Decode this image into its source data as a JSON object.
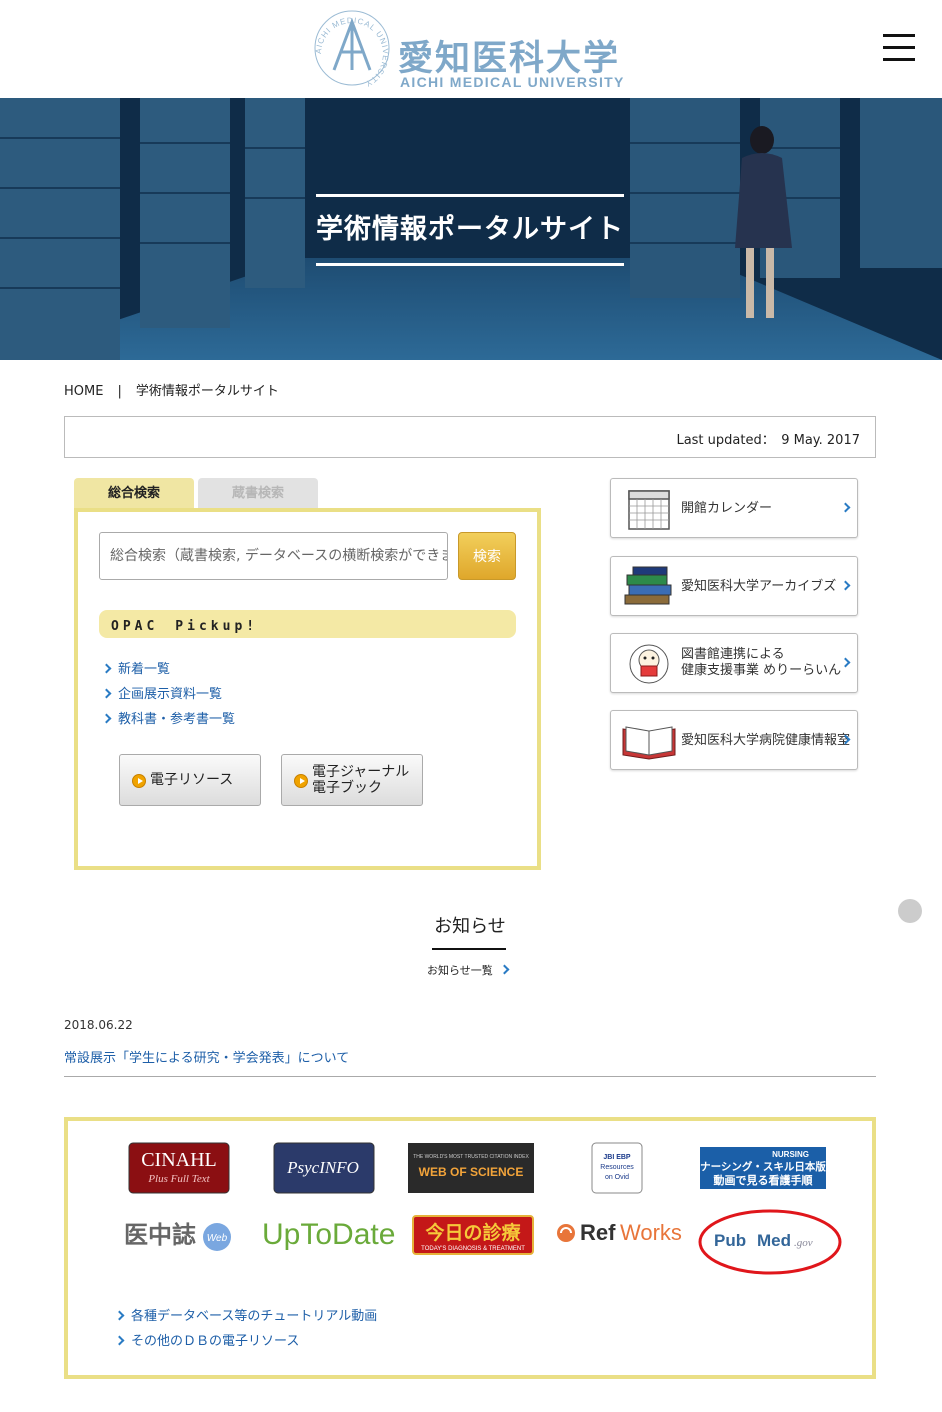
{
  "header": {
    "logo_ja": "愛知医科大学",
    "logo_en": "AICHI MEDICAL UNIVERSITY",
    "emblem_text": "AICHI MEDICAL UNIVERSITY"
  },
  "hero": {
    "title": "学術情報ポータルサイト"
  },
  "breadcrumb": {
    "home": "HOME",
    "separator": "|",
    "current": "学術情報ポータルサイト"
  },
  "updated": {
    "text": "Last updated：　9 May. 2017"
  },
  "search": {
    "tab_active": "総合検索",
    "tab_inactive": "蔵書検索",
    "placeholder": "総合検索（蔵書検索, データベースの横断検索ができます）",
    "button": "検索",
    "opac_title": "OPAC　Pickup!",
    "opac_links": [
      "新着一覧",
      "企画展示資料一覧",
      "教科書・参考書一覧"
    ],
    "resource_button": "電子リソース",
    "journal_button_line1": "電子ジャーナル",
    "journal_button_line2": "電子ブック"
  },
  "side_menu": {
    "calendar": "開館カレンダー",
    "archives": "愛知医科大学アーカイブズ",
    "health_line1": "図書館連携による",
    "health_line2": "健康支援事業 めりーらいん",
    "hospital": "愛知医科大学病院健康情報室"
  },
  "news": {
    "title": "お知らせ",
    "list_link": "お知らせ一覧",
    "items": [
      {
        "date": "2018.06.22",
        "title": "常設展示「学生による研究・学会発表」について"
      }
    ]
  },
  "databases": {
    "cinahl": "CINAHL",
    "cinahl_sub": "Plus Full Text",
    "psycinfo": "PsycINFO",
    "wos_tag": "THE WORLD'S MOST TRUSTED CITATION INDEX",
    "wos": "WEB OF SCIENCE",
    "jbi_line1": "JBI EBP",
    "jbi_line2": "Resources",
    "jbi_line3": "on Ovid",
    "nursing_tag": "NURSING",
    "nursing_line1": "ナーシング・スキル日本版",
    "nursing_line2": "動画で見る看護手順",
    "ichushi": "医中誌",
    "ichushi_web": "Web",
    "uptodate": "UpToDate",
    "konnichi": "今日の診療",
    "konnichi_sub": "TODAY'S DIAGNOSIS & TREATMENT",
    "refworks_ref": "Ref",
    "refworks_works": "Works",
    "pubmed_pub": "Pub",
    "pubmed_med": "Med",
    "pubmed_gov": ".gov",
    "links": [
      "各種データベース等のチュートリアル動画",
      "その他のＤＢの電子リソース"
    ]
  },
  "colors": {
    "accent_yellow": "#eadf86",
    "link_blue": "#1e5fa8",
    "logo_blue": "#7fa8c9",
    "circle_red": "#e0161b"
  }
}
